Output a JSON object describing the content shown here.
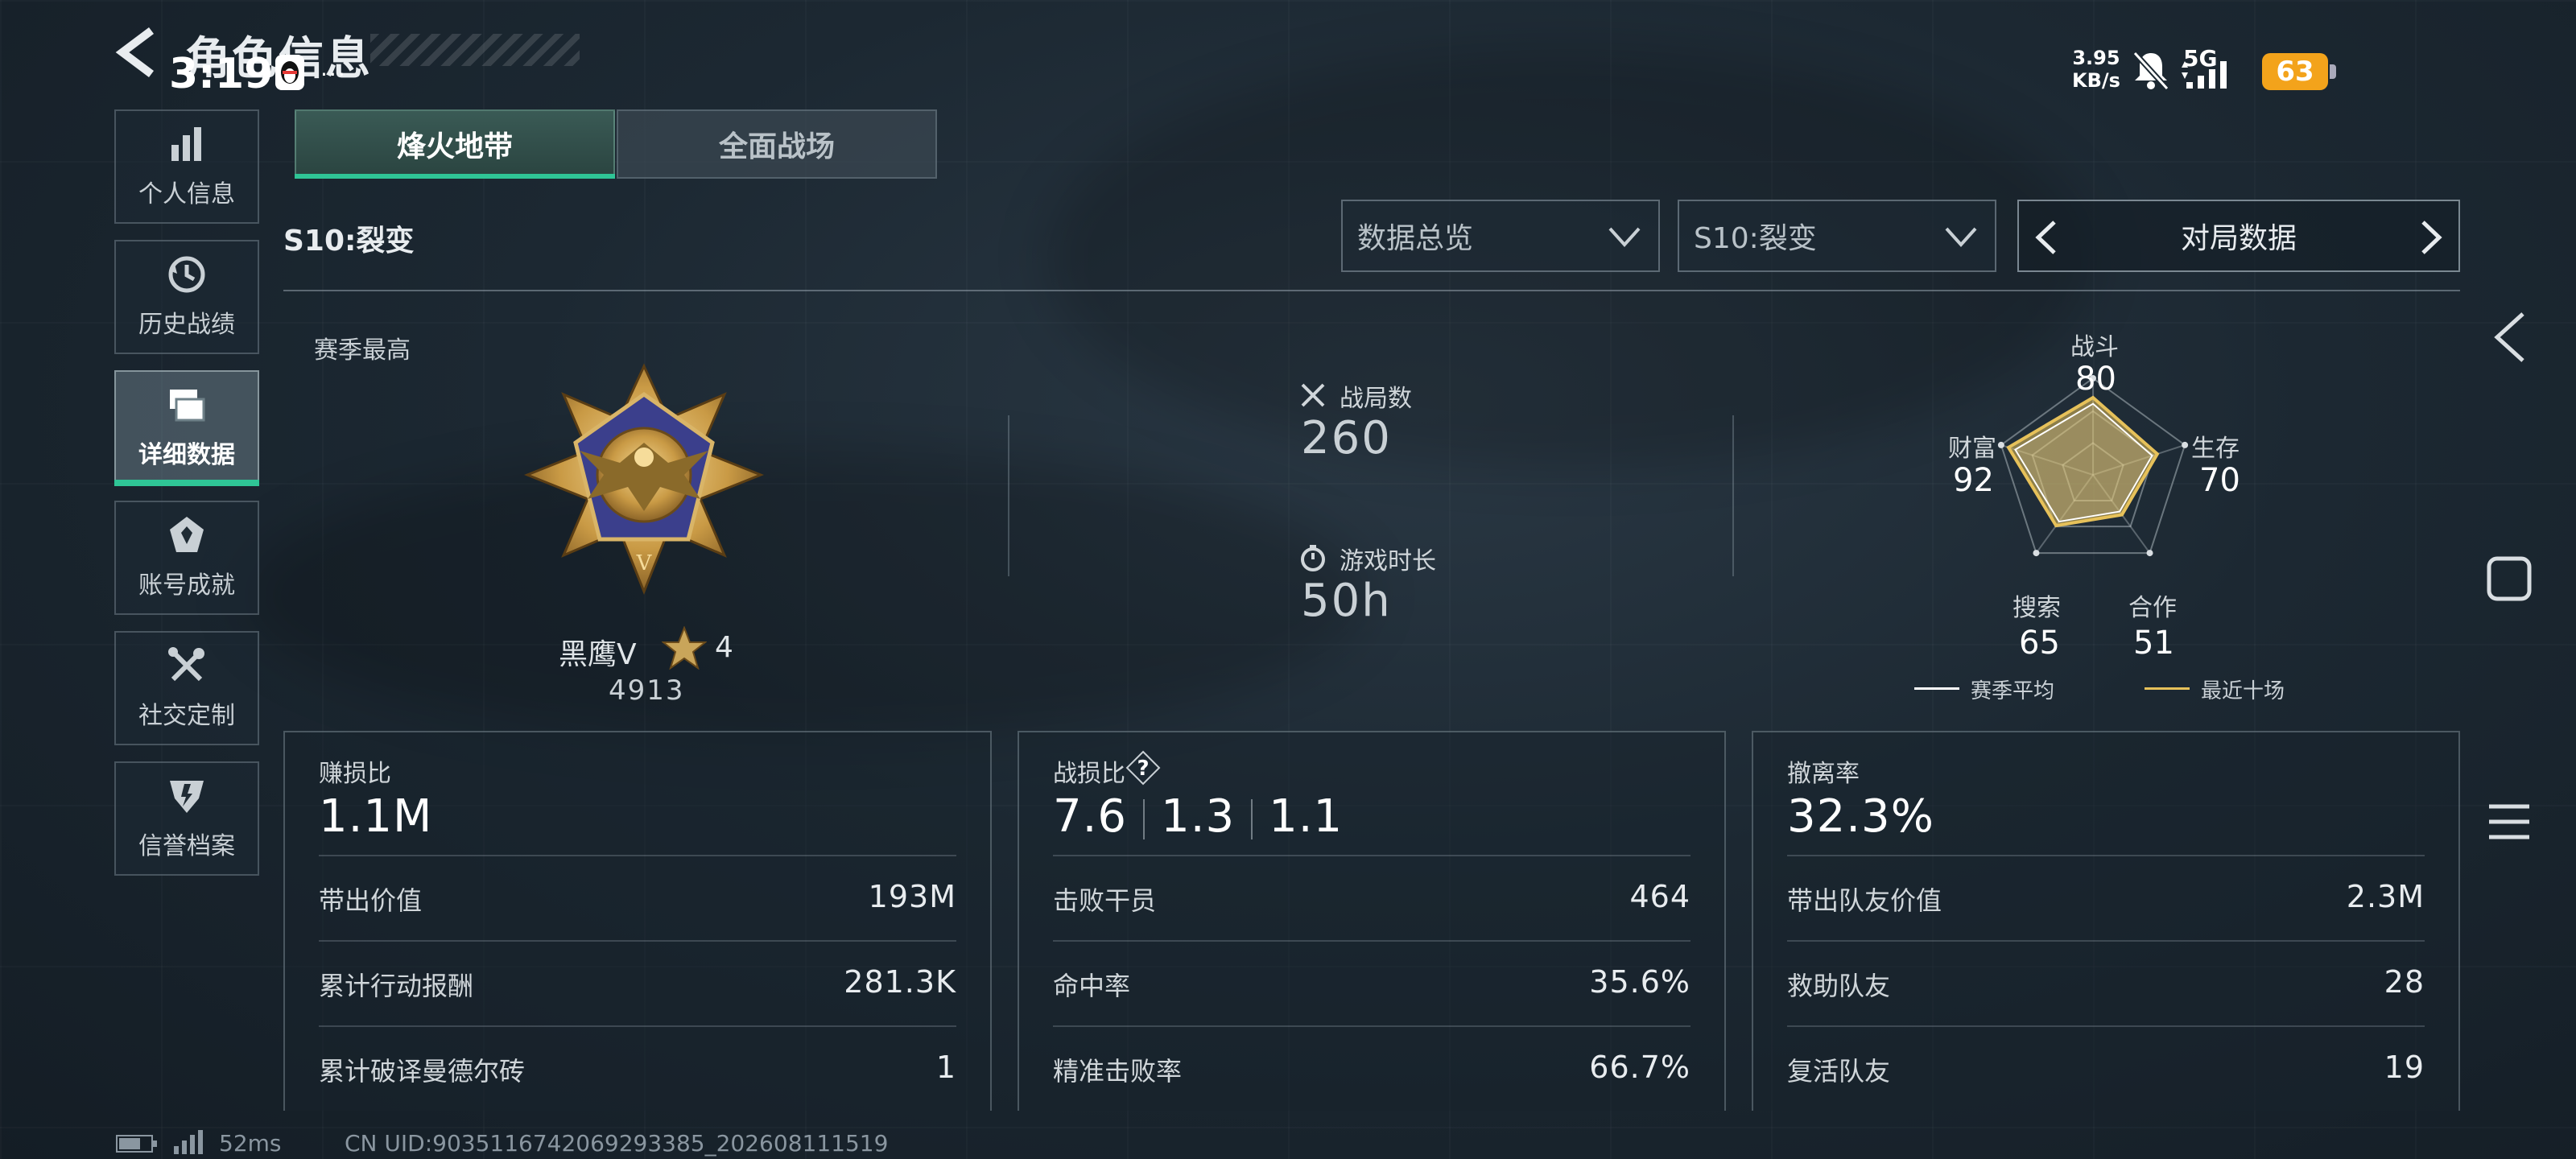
{
  "status_bar": {
    "time": "3:19",
    "more": "···",
    "speed_line1": "3.95",
    "speed_line2": "KB/s",
    "network": "5G",
    "battery": "63"
  },
  "header": {
    "title": "角色信息"
  },
  "sidebar": {
    "items": [
      {
        "label": "个人信息",
        "icon": "bar-chart-icon",
        "active": false
      },
      {
        "label": "历史战绩",
        "icon": "history-icon",
        "active": false
      },
      {
        "label": "详细数据",
        "icon": "cards-icon",
        "active": true
      },
      {
        "label": "账号成就",
        "icon": "achievement-icon",
        "active": false
      },
      {
        "label": "社交定制",
        "icon": "tools-icon",
        "active": false
      },
      {
        "label": "信誉档案",
        "icon": "shield-icon",
        "active": false
      }
    ]
  },
  "tabs": [
    {
      "label": "烽火地带",
      "active": true
    },
    {
      "label": "全面战场",
      "active": false
    }
  ],
  "season_label": "S10:裂变",
  "filters": {
    "overview": "数据总览",
    "season": "S10:裂变",
    "pager_label": "对局数据"
  },
  "overview": {
    "season_best_label": "赛季最高",
    "rank_name": "黑鹰Ⅴ",
    "rank_stars": "4",
    "rank_score": "4913",
    "matches_label": "战局数",
    "matches_value": "260",
    "playtime_label": "游戏时长",
    "playtime_value": "50h"
  },
  "radar": {
    "labels": {
      "combat": "战斗",
      "survival": "生存",
      "teamwork": "合作",
      "search": "搜索",
      "wealth": "财富"
    },
    "values": {
      "combat": "80",
      "survival": "70",
      "teamwork": "51",
      "search": "65",
      "wealth": "92"
    },
    "legend_season_avg": "赛季平均",
    "legend_recent_ten": "最近十场",
    "colors": {
      "season_avg": "#ffffff",
      "recent_ten": "#e6c15a"
    }
  },
  "cards": [
    {
      "head_label": "赚损比",
      "head_value": "1.1M",
      "rows": [
        {
          "k": "带出价值",
          "v": "193M"
        },
        {
          "k": "累计行动报酬",
          "v": "281.3K"
        },
        {
          "k": "累计破译曼德尔砖",
          "v": "1"
        }
      ]
    },
    {
      "head_label": "战损比",
      "help": "?",
      "ratios": [
        "7.6",
        "1.3",
        "1.1"
      ],
      "rows": [
        {
          "k": "击败干员",
          "v": "464"
        },
        {
          "k": "命中率",
          "v": "35.6%"
        },
        {
          "k": "精准击败率",
          "v": "66.7%"
        }
      ]
    },
    {
      "head_label": "撤离率",
      "head_value": "32.3%",
      "rows": [
        {
          "k": "带出队友价值",
          "v": "2.3M"
        },
        {
          "k": "救助队友",
          "v": "28"
        },
        {
          "k": "复活队友",
          "v": "19"
        }
      ]
    }
  ],
  "footer": {
    "ping": "52ms",
    "uid": "CN UID:9035116742069293385_202608111519"
  },
  "theme": {
    "accent": "#2fc596",
    "battery": "#f3a31b",
    "gold": "#e6c15a"
  }
}
